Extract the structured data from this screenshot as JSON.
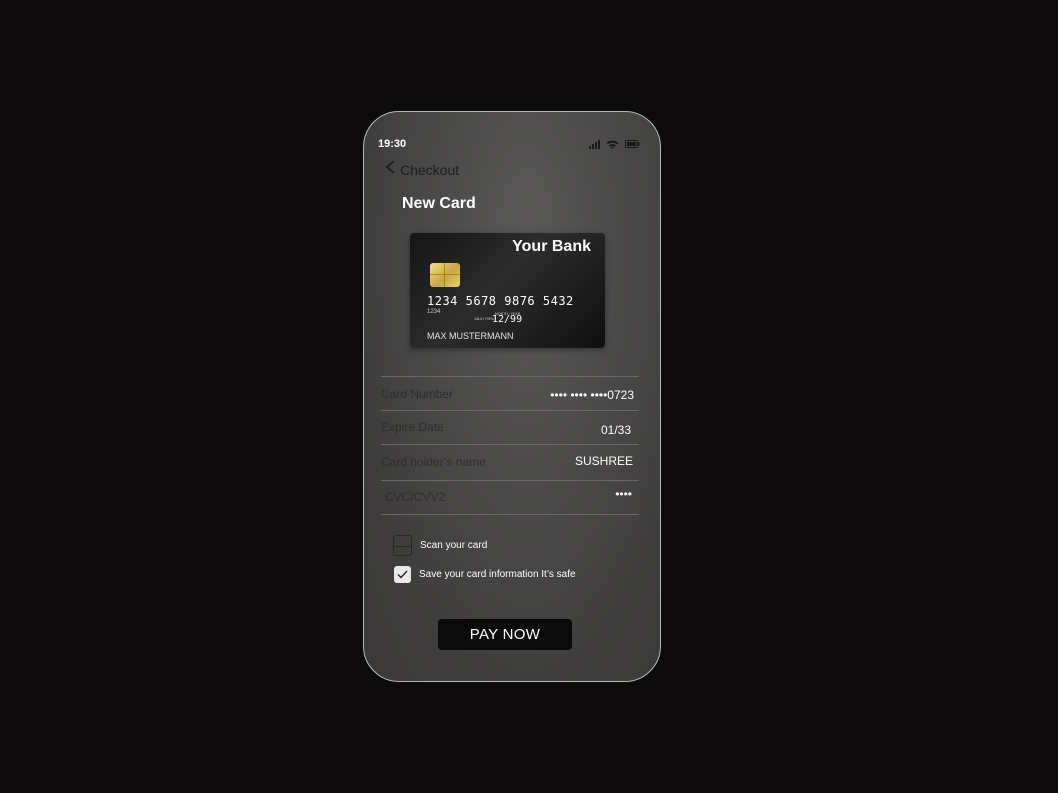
{
  "status_bar": {
    "time": "19:30",
    "icons": [
      "signal-icon",
      "wifi-icon",
      "battery-icon"
    ]
  },
  "header": {
    "back_label": "Checkout",
    "title": "New Card"
  },
  "card": {
    "bank_name": "Your Bank",
    "number": "1234  5678  9876  5432",
    "small_digits": "1234",
    "valid_label": "VALID THRU",
    "month_year_label": "MONTH / YEAR",
    "expiry": "12/99",
    "holder": "MAX MUSTERMANN"
  },
  "form": {
    "rows": [
      {
        "label": "Card Number",
        "value": "•••• •••• ••••0723"
      },
      {
        "label": "Expire Date",
        "value": "01/33"
      },
      {
        "label": "Card holder’s name",
        "value": "SUSHREE"
      },
      {
        "label": "CVC/CVV2",
        "value": "••••"
      }
    ]
  },
  "options": {
    "scan_label": "Scan your card",
    "scan_checked": false,
    "save_label": "Save your card information It’s safe",
    "save_checked": true
  },
  "actions": {
    "pay_label": "PAY NOW"
  },
  "colors": {
    "background": "#0d0b0c",
    "button": "#0a0a0a",
    "card": "#1a1a1a",
    "chip": "#d8bd55"
  }
}
